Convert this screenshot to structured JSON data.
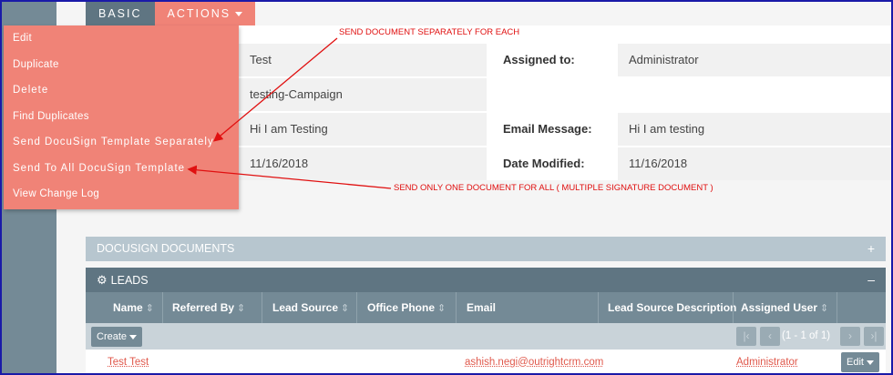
{
  "tabs": {
    "basic": "BASIC",
    "actions": "ACTIONS"
  },
  "actions_menu": {
    "items": [
      {
        "label": "Edit"
      },
      {
        "label": "Duplicate"
      },
      {
        "label": "Delete"
      },
      {
        "label": "Find Duplicates"
      },
      {
        "label": "Send DocuSign Template Separately"
      },
      {
        "label": "Send To All DocuSign Template"
      },
      {
        "label": "View Change Log"
      }
    ]
  },
  "detail": {
    "name_value": "Test",
    "campaign_value": "testing-Campaign",
    "description_value": "Hi I am Testing",
    "date_created_value": "11/16/2018",
    "assigned_to_label": "Assigned to:",
    "assigned_to_value": "Administrator",
    "email_message_label": "Email Message:",
    "email_message_value": "Hi I am testing",
    "date_modified_label": "Date Modified:",
    "date_modified_value": "11/16/2018"
  },
  "annotations": {
    "separate": "SEND DOCUMENT SEPARATELY FOR EACH",
    "all": "SEND ONLY ONE DOCUMENT FOR ALL ( MULTIPLE SIGNATURE DOCUMENT )"
  },
  "docusign_panel": {
    "title": "DOCUSIGN DOCUMENTS",
    "toggle": "+"
  },
  "leads_panel": {
    "title": "LEADS",
    "toggle": "–",
    "columns": [
      {
        "label": "Name",
        "sortable": true
      },
      {
        "label": "Referred By",
        "sortable": true
      },
      {
        "label": "Lead Source",
        "sortable": true
      },
      {
        "label": "Office Phone",
        "sortable": true
      },
      {
        "label": "Email",
        "sortable": false
      },
      {
        "label": "Lead Source Description",
        "sortable": false
      },
      {
        "label": "Assigned User",
        "sortable": true
      }
    ],
    "create_label": "Create",
    "pagination": "(1 - 1 of 1)",
    "rows": [
      {
        "name": "Test Test",
        "email": "ashish.negi@outrightcrm.com",
        "assigned_user": "Administrator",
        "edit_label": "Edit"
      }
    ]
  },
  "colors": {
    "accent": "#f08377",
    "nav": "#5f7582",
    "annotation": "#e01010",
    "link": "#e0594c"
  }
}
